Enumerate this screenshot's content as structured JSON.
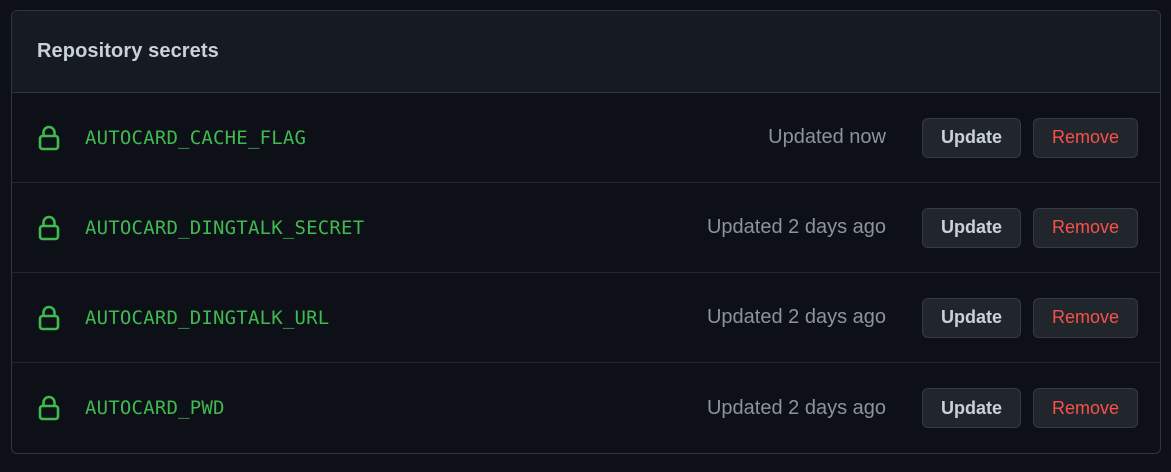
{
  "panel": {
    "title": "Repository secrets"
  },
  "secrets": [
    {
      "name": "AUTOCARD_CACHE_FLAG",
      "updated": "Updated now",
      "update_label": "Update",
      "remove_label": "Remove"
    },
    {
      "name": "AUTOCARD_DINGTALK_SECRET",
      "updated": "Updated 2 days ago",
      "update_label": "Update",
      "remove_label": "Remove"
    },
    {
      "name": "AUTOCARD_DINGTALK_URL",
      "updated": "Updated 2 days ago",
      "update_label": "Update",
      "remove_label": "Remove"
    },
    {
      "name": "AUTOCARD_PWD",
      "updated": "Updated 2 days ago",
      "update_label": "Update",
      "remove_label": "Remove"
    }
  ],
  "icons": {
    "secret": "lock-icon"
  },
  "colors": {
    "background": "#0d1117",
    "header": "#161b22",
    "secret_name": "#3fb950",
    "remove": "#f85149",
    "muted": "#8b949e",
    "border": "#30363d"
  }
}
